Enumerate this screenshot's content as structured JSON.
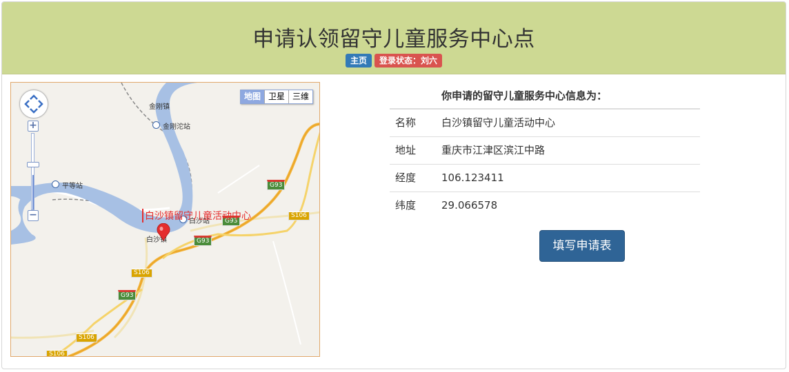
{
  "header": {
    "title": "申请认领留守儿童服务中心点",
    "home_badge": "主页",
    "login_badge": "登录状态：刘六"
  },
  "map": {
    "type_buttons": [
      "地图",
      "卫星",
      "三维"
    ],
    "active_type": "地图",
    "zoom_in": "+",
    "zoom_out": "−",
    "marker_label": "白沙镇留守儿童活动中心",
    "place_labels": {
      "jingang_town": "金刚镇",
      "jingang_station": "金刚沱站",
      "pingdeng_station": "平等站",
      "baisha_station": "白沙站",
      "baisha_town": "白沙镇"
    },
    "road_shields": [
      "G93",
      "G93",
      "G93",
      "G93",
      "S106",
      "S106",
      "S106",
      "S106"
    ]
  },
  "info": {
    "heading": "你申请的留守儿童服务中心信息为：",
    "rows": [
      {
        "label": "名称",
        "value": "白沙镇留守儿童活动中心"
      },
      {
        "label": "地址",
        "value": "重庆市江津区滨江中路"
      },
      {
        "label": "经度",
        "value": "106.123411"
      },
      {
        "label": "纬度",
        "value": "29.066578"
      }
    ]
  },
  "apply_button": "填写申请表",
  "colors": {
    "header_bg": "#cdd993",
    "badge_blue": "#337ab7",
    "badge_red": "#d9534f",
    "button_bg": "#2f6496",
    "river": "#a7c0e4",
    "marker": "#e52d2d"
  }
}
